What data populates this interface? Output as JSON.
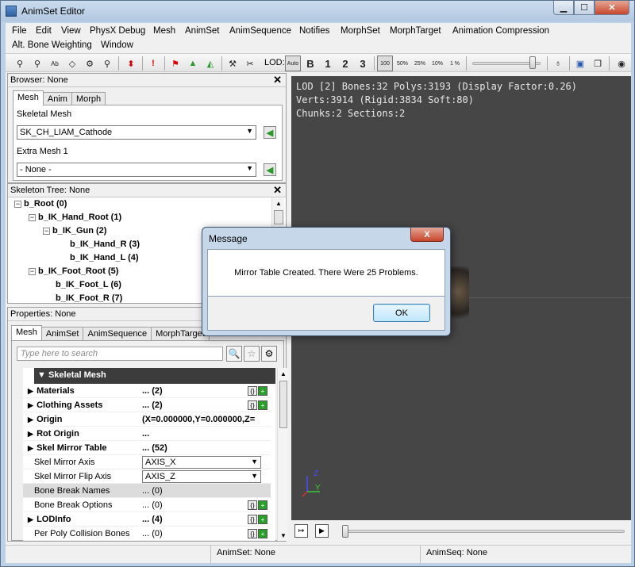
{
  "window": {
    "title": "AnimSet Editor"
  },
  "menu": [
    "File",
    "Edit",
    "View",
    "PhysX Debug",
    "Mesh",
    "AnimSet",
    "AnimSequence",
    "Notifies",
    "MorphSet",
    "MorphTarget",
    "Animation Compression",
    "Alt. Bone Weighting",
    "Window"
  ],
  "toolbar": {
    "lod_label": "LOD:",
    "auto": "Auto",
    "lod_b": "B",
    "lod_1": "1",
    "lod_2": "2",
    "lod_3": "3",
    "speeds": [
      "100",
      "50%",
      "25%",
      "10%",
      "1 %"
    ]
  },
  "browser": {
    "title": "Browser: None",
    "tabs": [
      "Mesh",
      "Anim",
      "Morph"
    ],
    "skeletal_mesh_label": "Skeletal Mesh",
    "skeletal_mesh_value": "SK_CH_LIAM_Cathode",
    "extra_mesh_label": "Extra Mesh 1",
    "extra_mesh_value": "- None -"
  },
  "skeleton": {
    "title": "Skeleton Tree: None",
    "nodes": [
      "b_Root (0)",
      "b_IK_Hand_Root (1)",
      "b_IK_Gun (2)",
      "b_IK_Hand_R (3)",
      "b_IK_Hand_L (4)",
      "b_IK_Foot_Root (5)",
      "b_IK_Foot_L (6)",
      "b_IK_Foot_R (7)"
    ]
  },
  "properties": {
    "title": "Properties: None",
    "tabs": [
      "Mesh",
      "AnimSet",
      "AnimSequence",
      "MorphTarget"
    ],
    "search_placeholder": "Type here to search",
    "category": "Skeletal Mesh",
    "rows": [
      {
        "name": "Materials",
        "value": "... (2)"
      },
      {
        "name": "Clothing Assets",
        "value": "... (2)"
      },
      {
        "name": "Origin",
        "value": "(X=0.000000,Y=0.000000,Z="
      },
      {
        "name": "Rot Origin",
        "value": "..."
      },
      {
        "name": "Skel Mirror Table",
        "value": "... (52)"
      },
      {
        "name": "Skel Mirror Axis",
        "value": "AXIS_X"
      },
      {
        "name": "Skel Mirror Flip Axis",
        "value": "AXIS_Z"
      },
      {
        "name": "Bone Break Names",
        "value": "... (0)"
      },
      {
        "name": "Bone Break Options",
        "value": "... (0)"
      },
      {
        "name": "LODInfo",
        "value": "... (4)"
      },
      {
        "name": "Per Poly Collision Bones",
        "value": "... (0)"
      }
    ]
  },
  "viewport": {
    "line1": "LOD [2] Bones:32 Polys:3193 (Display Factor:0.26)",
    "line2": "Verts:3914 (Rigid:3834 Soft:80)",
    "line3": "Chunks:2 Sections:2",
    "axis_z": "Z",
    "axis_y": "Y"
  },
  "dialog": {
    "title": "Message",
    "close": "X",
    "message": "Mirror Table Created. There Were 25 Problems.",
    "ok": "OK"
  },
  "status": {
    "animset": "AnimSet: None",
    "animseq": "AnimSeq: None"
  }
}
